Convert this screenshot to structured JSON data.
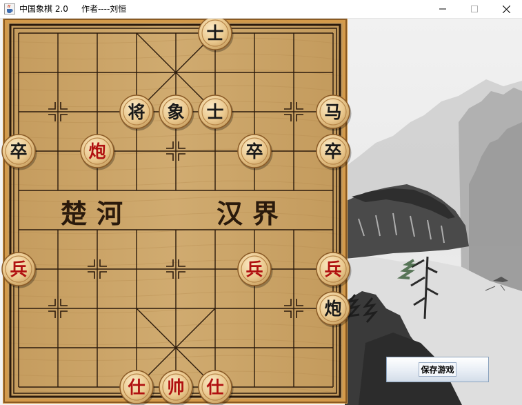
{
  "window": {
    "title": "中国象棋 2.0     作者----刘恒",
    "icon": "java-cup-icon"
  },
  "controls": {
    "minimize": "minimize-icon",
    "maximize": "maximize-icon",
    "close": "close-icon"
  },
  "board": {
    "river_left": "楚河",
    "river_right": "汉界",
    "colors": {
      "wood": "#c9a468",
      "frame": "#d49a4a",
      "line": "#2b1a0c",
      "red_piece_text": "#b01010",
      "black_piece_text": "#1a1a1a"
    },
    "pieces": [
      {
        "char": "士",
        "side": "black",
        "file": 5,
        "rank": 0
      },
      {
        "char": "将",
        "side": "black",
        "file": 3,
        "rank": 2
      },
      {
        "char": "象",
        "side": "black",
        "file": 4,
        "rank": 2
      },
      {
        "char": "士",
        "side": "black",
        "file": 5,
        "rank": 2
      },
      {
        "char": "马",
        "side": "black",
        "file": 8,
        "rank": 2
      },
      {
        "char": "卒",
        "side": "black",
        "file": 0,
        "rank": 3
      },
      {
        "char": "炮",
        "side": "red",
        "file": 2,
        "rank": 3
      },
      {
        "char": "卒",
        "side": "black",
        "file": 6,
        "rank": 3
      },
      {
        "char": "卒",
        "side": "black",
        "file": 8,
        "rank": 3
      },
      {
        "char": "兵",
        "side": "red",
        "file": 0,
        "rank": 6
      },
      {
        "char": "兵",
        "side": "red",
        "file": 6,
        "rank": 6
      },
      {
        "char": "兵",
        "side": "red",
        "file": 8,
        "rank": 6
      },
      {
        "char": "炮",
        "side": "black",
        "file": 8,
        "rank": 7
      },
      {
        "char": "仕",
        "side": "red",
        "file": 3,
        "rank": 9
      },
      {
        "char": "帅",
        "side": "red",
        "file": 4,
        "rank": 9
      },
      {
        "char": "仕",
        "side": "red",
        "file": 5,
        "rank": 9
      }
    ]
  },
  "save_button": {
    "label": "保存游戏"
  }
}
